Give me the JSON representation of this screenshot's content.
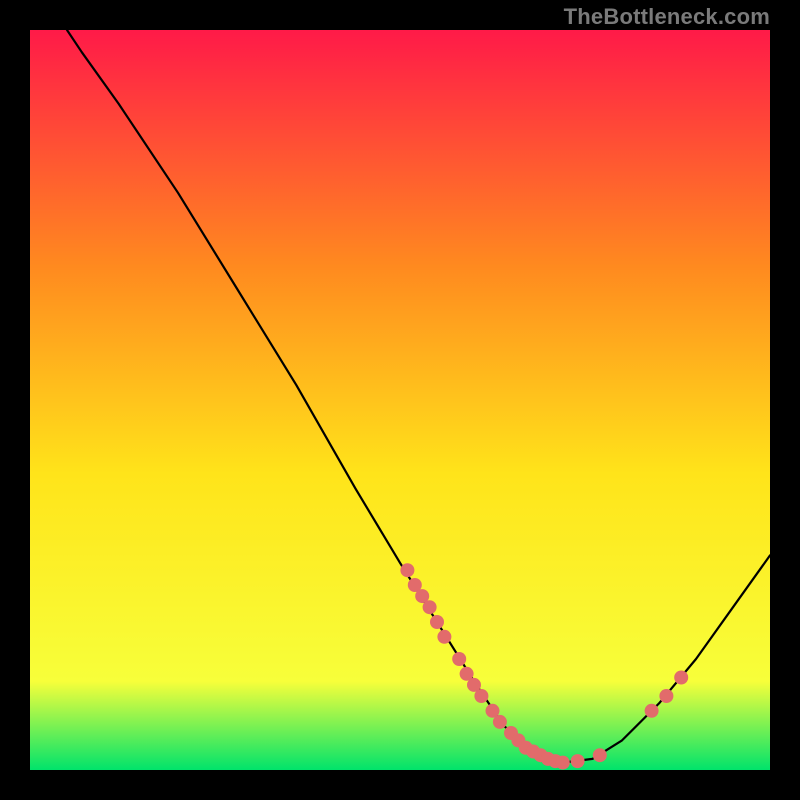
{
  "attribution": "TheBottleneck.com",
  "chart_data": {
    "type": "line",
    "title": "",
    "xlabel": "",
    "ylabel": "",
    "xlim": [
      0,
      100
    ],
    "ylim": [
      0,
      100
    ],
    "gradient_colors": {
      "top": "#ff1a48",
      "upper_mid": "#ff8a1f",
      "mid": "#ffe41a",
      "lower_mid": "#f7ff3a",
      "bottom": "#00e36b"
    },
    "series": [
      {
        "name": "bottleneck-curve",
        "color": "#000000",
        "points": [
          {
            "x": 5.0,
            "y": 100.0
          },
          {
            "x": 7.0,
            "y": 97.0
          },
          {
            "x": 12.0,
            "y": 90.0
          },
          {
            "x": 20.0,
            "y": 78.0
          },
          {
            "x": 28.0,
            "y": 65.0
          },
          {
            "x": 36.0,
            "y": 52.0
          },
          {
            "x": 44.0,
            "y": 38.0
          },
          {
            "x": 50.0,
            "y": 28.0
          },
          {
            "x": 55.0,
            "y": 20.0
          },
          {
            "x": 60.0,
            "y": 12.0
          },
          {
            "x": 64.0,
            "y": 6.0
          },
          {
            "x": 68.0,
            "y": 2.5
          },
          {
            "x": 72.0,
            "y": 1.0
          },
          {
            "x": 76.0,
            "y": 1.5
          },
          {
            "x": 80.0,
            "y": 4.0
          },
          {
            "x": 85.0,
            "y": 9.0
          },
          {
            "x": 90.0,
            "y": 15.0
          },
          {
            "x": 95.0,
            "y": 22.0
          },
          {
            "x": 100.0,
            "y": 29.0
          }
        ]
      },
      {
        "name": "sample-points",
        "color": "#e26b6b",
        "points": [
          {
            "x": 51.0,
            "y": 27.0
          },
          {
            "x": 52.0,
            "y": 25.0
          },
          {
            "x": 53.0,
            "y": 23.5
          },
          {
            "x": 54.0,
            "y": 22.0
          },
          {
            "x": 55.0,
            "y": 20.0
          },
          {
            "x": 56.0,
            "y": 18.0
          },
          {
            "x": 58.0,
            "y": 15.0
          },
          {
            "x": 59.0,
            "y": 13.0
          },
          {
            "x": 60.0,
            "y": 11.5
          },
          {
            "x": 61.0,
            "y": 10.0
          },
          {
            "x": 62.5,
            "y": 8.0
          },
          {
            "x": 63.5,
            "y": 6.5
          },
          {
            "x": 65.0,
            "y": 5.0
          },
          {
            "x": 66.0,
            "y": 4.0
          },
          {
            "x": 67.0,
            "y": 3.0
          },
          {
            "x": 68.0,
            "y": 2.5
          },
          {
            "x": 69.0,
            "y": 2.0
          },
          {
            "x": 70.0,
            "y": 1.5
          },
          {
            "x": 71.0,
            "y": 1.2
          },
          {
            "x": 72.0,
            "y": 1.0
          },
          {
            "x": 74.0,
            "y": 1.2
          },
          {
            "x": 77.0,
            "y": 2.0
          },
          {
            "x": 84.0,
            "y": 8.0
          },
          {
            "x": 86.0,
            "y": 10.0
          },
          {
            "x": 88.0,
            "y": 12.5
          }
        ]
      }
    ]
  }
}
